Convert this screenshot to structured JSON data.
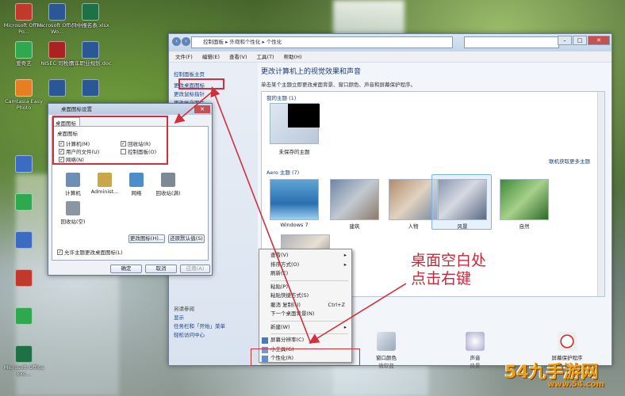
{
  "desktop_icons": [
    {
      "label": "Microsoft Office Po...",
      "color": "#c0392b",
      "col": 0,
      "row": 0
    },
    {
      "label": "Microsoft Office Wo...",
      "color": "#2b5797",
      "col": 1,
      "row": 0
    },
    {
      "label": "只中报名表.xlsx",
      "color": "#1e7145",
      "col": 2,
      "row": 0
    },
    {
      "label": "爱奇艺",
      "color": "#2fa84f",
      "col": 0,
      "row": 1
    },
    {
      "label": "NISEC 司税控",
      "color": "#aa2222",
      "col": 1,
      "row": 1
    },
    {
      "label": "青年职业规划.doc",
      "color": "#2b5797",
      "col": 2,
      "row": 1
    },
    {
      "label": "Camtasia Easy Photo",
      "color": "#e67e22",
      "col": 0,
      "row": 2
    },
    {
      "label": "",
      "color": "#2b5797",
      "col": 1,
      "row": 2
    },
    {
      "label": "",
      "color": "#2b5797",
      "col": 2,
      "row": 2
    },
    {
      "label": "",
      "color": "#3b6cc2",
      "col": 0,
      "row": 4
    },
    {
      "label": "",
      "color": "#2fa84f",
      "col": 0,
      "row": 5
    },
    {
      "label": "",
      "color": "#3b6cc2",
      "col": 0,
      "row": 6
    },
    {
      "label": "",
      "color": "#c0392b",
      "col": 0,
      "row": 7
    },
    {
      "label": "",
      "color": "#2fa84f",
      "col": 0,
      "row": 8
    },
    {
      "label": "Microsoft Office Exc...",
      "color": "#1e7145",
      "col": 0,
      "row": 9
    }
  ],
  "window": {
    "address": "控制面板 ▸ 外观和个性化 ▸ 个性化",
    "menu": [
      "文件(F)",
      "编辑(E)",
      "查看(V)",
      "工具(T)",
      "帮助(H)"
    ],
    "left_links": [
      "控制面板主页",
      "更改桌面图标",
      "更改鼠标指针",
      "更改帐户图片"
    ],
    "left_see_also_title": "另请参阅",
    "left_see_also": [
      "显示",
      "任务栏和「开始」菜单",
      "轻松访问中心"
    ],
    "heading": "更改计算机上的视觉效果和声音",
    "subheading": "单击某个主题立即更改桌面背景、窗口颜色、声音和屏幕保护程序。",
    "my_themes_label": "我的主题 (1)",
    "unsaved_theme": "未保存的主题",
    "online_link": "联机获取更多主题",
    "aero_label": "Aero 主题 (7)",
    "aero_themes": [
      "Windows 7",
      "建筑",
      "人物",
      "风景",
      "自然"
    ],
    "bottom": [
      {
        "label": "窗口颜色",
        "value": "微软蓝"
      },
      {
        "label": "声音",
        "value": "风景"
      },
      {
        "label": "屏幕保护程序",
        "value": "无"
      }
    ]
  },
  "dialog": {
    "title": "桌面图标设置",
    "tab": "桌面图标",
    "group": "桌面图标",
    "checks": [
      {
        "label": "计算机(M)",
        "checked": true
      },
      {
        "label": "回收站(R)",
        "checked": true
      },
      {
        "label": "用户的文件(U)",
        "checked": true
      },
      {
        "label": "控制面板(O)",
        "checked": false
      },
      {
        "label": "网络(N)",
        "checked": true
      }
    ],
    "icons": [
      "计算机",
      "Administ...",
      "网络",
      "回收站(满)",
      "回收站(空)"
    ],
    "btn_change_icon": "更改图标(H)...",
    "btn_restore": "还原默认值(S)",
    "allow_themes": "允许主题更改桌面图标(L)",
    "ok": "确定",
    "cancel": "取消",
    "apply": "应用(A)"
  },
  "context_menu": [
    {
      "label": "查看(V)",
      "arrow": true
    },
    {
      "label": "排序方式(O)",
      "arrow": true
    },
    {
      "label": "刷新(E)"
    },
    {
      "sep": true
    },
    {
      "label": "粘贴(P)"
    },
    {
      "label": "粘贴快捷方式(S)"
    },
    {
      "label": "撤消 复制(U)",
      "shortcut": "Ctrl+Z"
    },
    {
      "label": "下一个桌面背景(N)"
    },
    {
      "sep": true
    },
    {
      "label": "新建(W)",
      "arrow": true
    },
    {
      "sep": true
    },
    {
      "label": "屏幕分辨率(C)"
    },
    {
      "label": "小工具(G)"
    },
    {
      "label": "个性化(R)"
    }
  ],
  "annotation": [
    "桌面空白处",
    "点击右键"
  ],
  "watermark": {
    "main": "54九手游网",
    "sub": "www.54.com"
  },
  "colors": {
    "annotation_red": "#d0303d",
    "link_blue": "#1a3f8a"
  }
}
